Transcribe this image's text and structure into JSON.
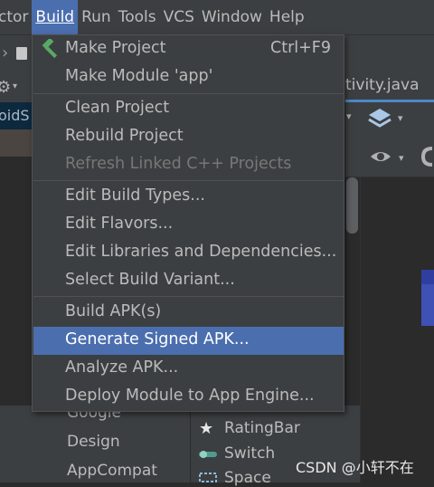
{
  "menubar": {
    "items": [
      {
        "label": "ctor",
        "active": false
      },
      {
        "label": "Build",
        "active": true
      },
      {
        "label": "Run",
        "active": false
      },
      {
        "label": "Tools",
        "active": false
      },
      {
        "label": "VCS",
        "active": false
      },
      {
        "label": "Window",
        "active": false
      },
      {
        "label": "Help",
        "active": false
      }
    ]
  },
  "editor": {
    "tab_partial": "tivity.java",
    "left_partial": "oidS"
  },
  "build_menu": {
    "items": [
      {
        "label": "Make Project",
        "shortcut": "Ctrl+F9",
        "icon": "hammer-icon",
        "enabled": true
      },
      {
        "label": "Make Module 'app'",
        "enabled": true
      },
      {
        "label": "Clean Project",
        "enabled": true
      },
      {
        "label": "Rebuild Project",
        "enabled": true
      },
      {
        "label": "Refresh Linked C++ Projects",
        "enabled": false
      },
      {
        "label": "Edit Build Types...",
        "enabled": true
      },
      {
        "label": "Edit Flavors...",
        "enabled": true
      },
      {
        "label": "Edit Libraries and Dependencies...",
        "enabled": true
      },
      {
        "label": "Select Build Variant...",
        "enabled": true
      },
      {
        "label": "Build APK(s)",
        "enabled": true
      },
      {
        "label": "Generate Signed APK...",
        "enabled": true,
        "selected": true
      },
      {
        "label": "Analyze APK...",
        "enabled": true
      },
      {
        "label": "Deploy Module to App Engine...",
        "enabled": true
      }
    ]
  },
  "palette": {
    "categories": [
      "Google",
      "Design",
      "AppCompat"
    ],
    "items": [
      "RatingBar",
      "Switch",
      "Space"
    ]
  },
  "watermark": "CSDN @小轩不在",
  "colors": {
    "menu_highlight": "#4b6eaf",
    "hammer": "#59a869",
    "background": "#3c3f41"
  }
}
